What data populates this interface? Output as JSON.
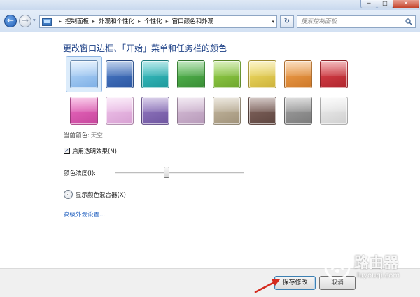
{
  "window": {
    "minimize_glyph": "─",
    "maximize_glyph": "□",
    "close_glyph": "✕"
  },
  "nav": {
    "back_glyph": "←",
    "forward_glyph": "→",
    "breadcrumbs": [
      "控制面板",
      "外观和个性化",
      "个性化",
      "窗口颜色和外观"
    ],
    "breadcrumb_separator": "▸",
    "refresh_glyph": "↻",
    "search_placeholder": "搜索控制面板"
  },
  "content": {
    "heading": "更改窗口边框、「开始」菜单和任务栏的颜色",
    "swatches": [
      {
        "color": "#bcdcfb",
        "edge": "#7fb0e6"
      },
      {
        "color": "#4f7fcb",
        "edge": "#2d58a3"
      },
      {
        "color": "#3fc6c9",
        "edge": "#1f9a9c"
      },
      {
        "color": "#5bc156",
        "edge": "#3a8e36"
      },
      {
        "color": "#9bd74e",
        "edge": "#6fa72e"
      },
      {
        "color": "#f6e36b",
        "edge": "#cdb33c"
      },
      {
        "color": "#f5a552",
        "edge": "#cf7a2a"
      },
      {
        "color": "#e2474f",
        "edge": "#b0262e"
      },
      {
        "color": "#ef6fc4",
        "edge": "#c7479d"
      },
      {
        "color": "#f4c9ef",
        "edge": "#d7a0d2"
      },
      {
        "color": "#9a7fc7",
        "edge": "#6f56a0"
      },
      {
        "color": "#dcc4dd",
        "edge": "#b79ab9"
      },
      {
        "color": "#cbbfa6",
        "edge": "#a0927a"
      },
      {
        "color": "#8a6b64",
        "edge": "#5e4640"
      },
      {
        "color": "#a7a7a7",
        "edge": "#7b7b7b"
      },
      {
        "color": "#f3f3f3",
        "edge": "#cfcfcf"
      }
    ],
    "current_color_label": "当前颜色:",
    "current_color_value": "天空",
    "transparency_checked_glyph": "✓",
    "transparency_label": "启用透明效果(N)",
    "intensity_label": "颜色浓度(I):",
    "intensity_level": 0.4,
    "mixer_glyph": "⌄",
    "mixer_label": "显示颜色混合器(X)",
    "advanced_link": "高级外观设置..."
  },
  "footer": {
    "save_label": "保存修改",
    "cancel_label": "取消"
  },
  "watermark": {
    "name": "路由器",
    "url": "luyouqi.com"
  }
}
